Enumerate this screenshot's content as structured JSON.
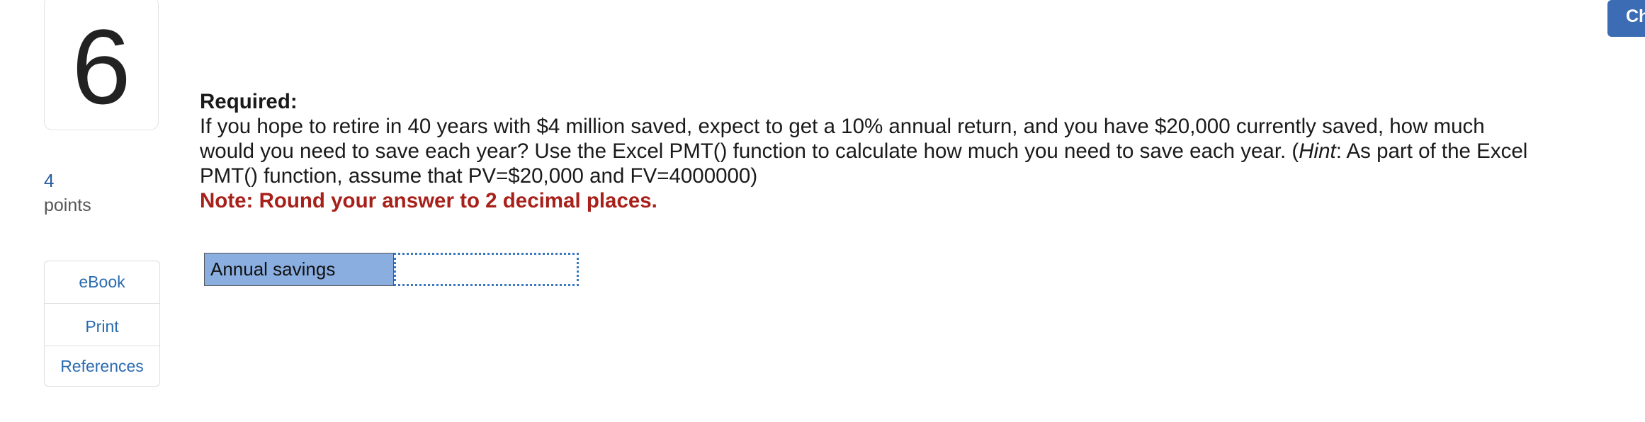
{
  "question": {
    "number": "6",
    "points_value": "4",
    "points_label": "points",
    "heading": "Required:",
    "body_part1": "If you hope to retire in 40 years with $4 million saved, expect to get a 10% annual return, and you have $20,000 currently saved, how much would you need to save each year? Use the Excel PMT() function to calculate how much you need to save each year. (",
    "hint_word": "Hint",
    "body_part2": ": As part of the Excel PMT() function, assume that PV=$20,000 and FV=4000000)",
    "note": "Note: Round your answer to 2 decimal places."
  },
  "resources": {
    "ebook": "eBook",
    "print": "Print",
    "references": "References"
  },
  "answer": {
    "label": "Annual savings",
    "value": ""
  },
  "corner_button": {
    "label": "Ch"
  },
  "colors": {
    "accent": "#3b6cb4",
    "link": "#2a6bb0",
    "note": "#a8201a",
    "label_fill": "#8aaee0"
  }
}
